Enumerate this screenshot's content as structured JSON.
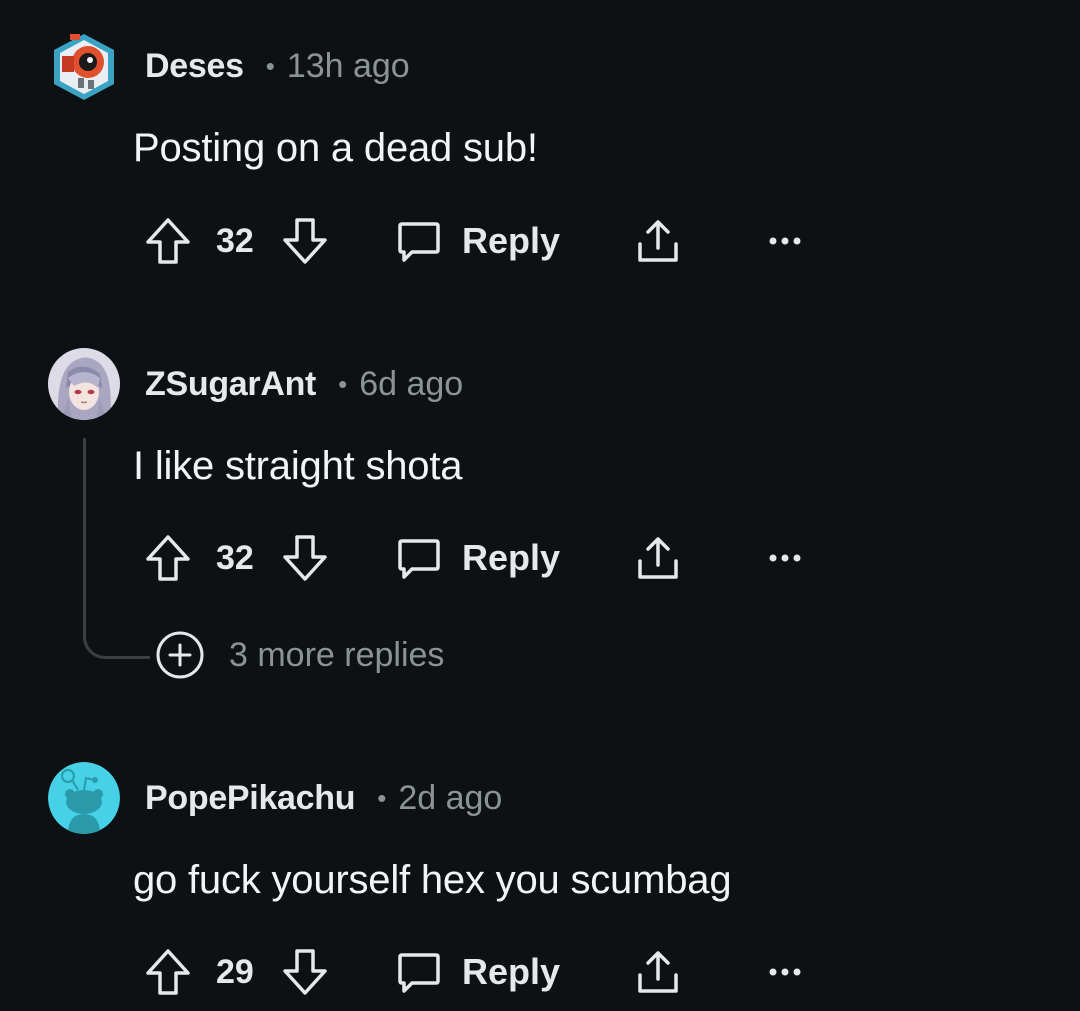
{
  "comments": [
    {
      "username": "Deses",
      "separator": "•",
      "time": "13h ago",
      "text": "Posting on a dead sub!",
      "votes": "32",
      "reply_label": "Reply",
      "avatar_icon": "robot-avatar-icon"
    },
    {
      "username": "ZSugarAnt",
      "separator": "•",
      "time": "6d ago",
      "text": "I like straight shota",
      "votes": "32",
      "reply_label": "Reply",
      "avatar_icon": "anime-character-avatar-icon",
      "more_replies": "3 more replies"
    },
    {
      "username": "PopePikachu",
      "separator": "•",
      "time": "2d ago",
      "text": "go fuck yourself hex you scumbag",
      "votes": "29",
      "reply_label": "Reply",
      "avatar_icon": "snoo-avatar-icon"
    }
  ],
  "colors": {
    "background": "#0e1113",
    "text_primary": "#f2f4f5",
    "text_secondary": "#8b9396",
    "thread_line": "#3a3f42",
    "snoo_avatar_bg": "#46d1e6"
  }
}
